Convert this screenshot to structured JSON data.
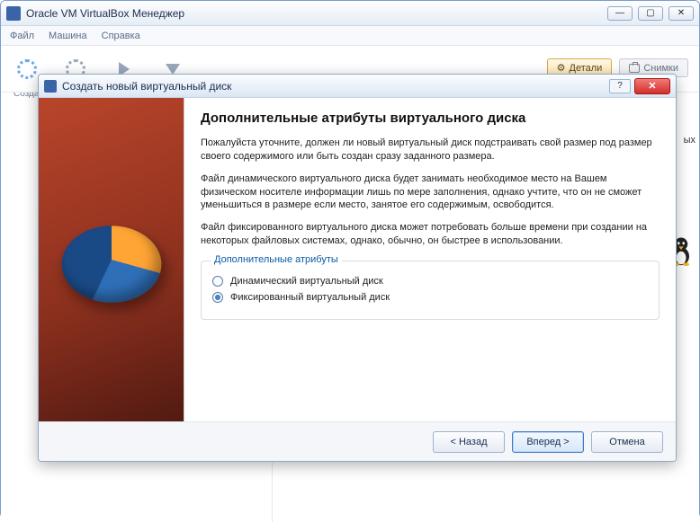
{
  "mainWindow": {
    "title": "Oracle VM VirtualBox Менеджер",
    "menu": {
      "file": "Файл",
      "machine": "Машина",
      "help": "Справка"
    },
    "toolbar": {
      "create": "Созда"
    },
    "tabs": {
      "details": "Детали",
      "snapshots": "Снимки"
    },
    "rightSnippet": "ых"
  },
  "dialog": {
    "title": "Создать новый виртуальный диск",
    "heading": "Дополнительные атрибуты виртуального диска",
    "para1": "Пожалуйста уточните, должен ли новый виртуальный диск подстраивать свой размер под размер своего содержимого или быть создан сразу заданного размера.",
    "para2": "Файл динамического виртуального диска будет занимать необходимое место на Вашем физическом носителе информации лишь по мере заполнения, однако учтите, что он не сможет уменьшиться в размере если место, занятое его содержимым, освободится.",
    "para3": "Файл фиксированного виртуального диска может потребовать больше времени при создании на некоторых файловых системах, однако, обычно, он быстрее в использовании.",
    "fieldsetLegend": "Дополнительные атрибуты",
    "radio1": "Динамический виртуальный диск",
    "radio2": "Фиксированный виртуальный диск",
    "buttons": {
      "back": "< Назад",
      "next": "Вперед >",
      "cancel": "Отмена"
    },
    "helpGlyph": "?",
    "closeGlyph": "✕"
  },
  "winButtons": {
    "min": "—",
    "max": "▢",
    "close": "✕"
  }
}
